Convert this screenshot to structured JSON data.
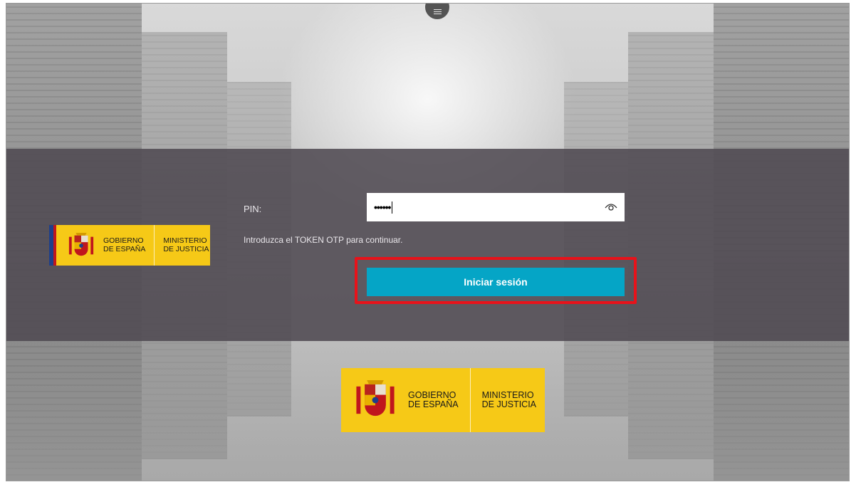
{
  "header": {
    "menu_icon": "hamburger-icon"
  },
  "login": {
    "pin_label": "PIN:",
    "pin_value": "••••••",
    "show_pin_icon": "eye-icon",
    "hint": "Introduzca el TOKEN OTP para continuar.",
    "submit_label": "Iniciar sesión",
    "highlight_color": "#e8121a",
    "button_color": "#05a5c6"
  },
  "branding": {
    "gobierno": "GOBIERNO\nDE ESPAÑA",
    "ministerio": "MINISTERIO\nDE JUSTICIA",
    "logo_color": "#f6c917"
  }
}
